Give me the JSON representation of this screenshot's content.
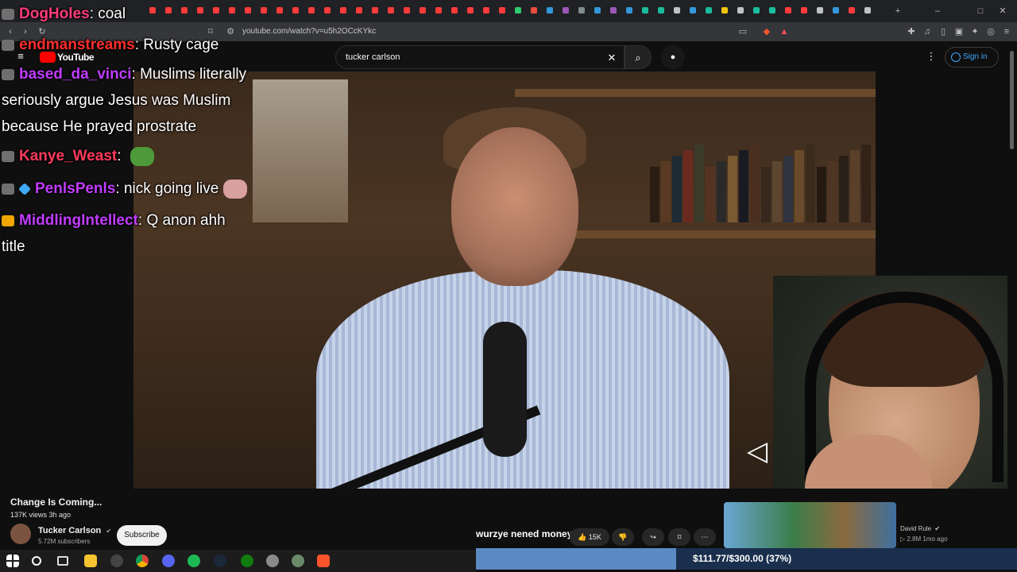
{
  "browser": {
    "url": "youtube.com/watch?v=u5h2OCcKYkc"
  },
  "youtube": {
    "logo_text": "YouTube",
    "search_value": "tucker carlson",
    "signin_label": "Sign in"
  },
  "chat": [
    {
      "user": "DogHoles",
      "message": ": coal",
      "color": "#ff3b7a"
    },
    {
      "user": "endmanstreams",
      "message": ": Rusty cage",
      "color": "#ff2d2d"
    },
    {
      "user": "based_da_vinci",
      "message": ": Muslims literally",
      "color": "#c13cff"
    },
    {
      "user": "",
      "message": "seriously argue Jesus was Muslim",
      "color": "#ffffff"
    },
    {
      "user": "",
      "message": "because He prayed prostrate",
      "color": "#ffffff"
    },
    {
      "user": "Kanye_Weast",
      "message": ": ",
      "color": "#ff3b5c"
    },
    {
      "user": "PenlsPenls",
      "message": ": nick going live",
      "color": "#c13cff"
    },
    {
      "user": "MiddlingIntellect",
      "message": ": Q anon ahh",
      "color": "#c13cff"
    },
    {
      "user": "",
      "message": "title",
      "color": "#ffffff"
    }
  ],
  "video": {
    "title": "Change Is Coming...",
    "meta": "137K views  3h ago",
    "channel": "Tucker Carlson",
    "subscribers": "5.72M subscribers",
    "subscribe_label": "Subscribe",
    "likes": "15K"
  },
  "tts": "wurzye nened money",
  "recommended": {
    "channel": "David Rule",
    "meta": "2.8M  1mo ago"
  },
  "donation": {
    "label": "$111.77/$300.00 (37%)",
    "progress": 0.37
  },
  "colors": {
    "yt_red": "#ff0000",
    "link_blue": "#3ea6ff",
    "donation_fill": "#5b89c2"
  }
}
